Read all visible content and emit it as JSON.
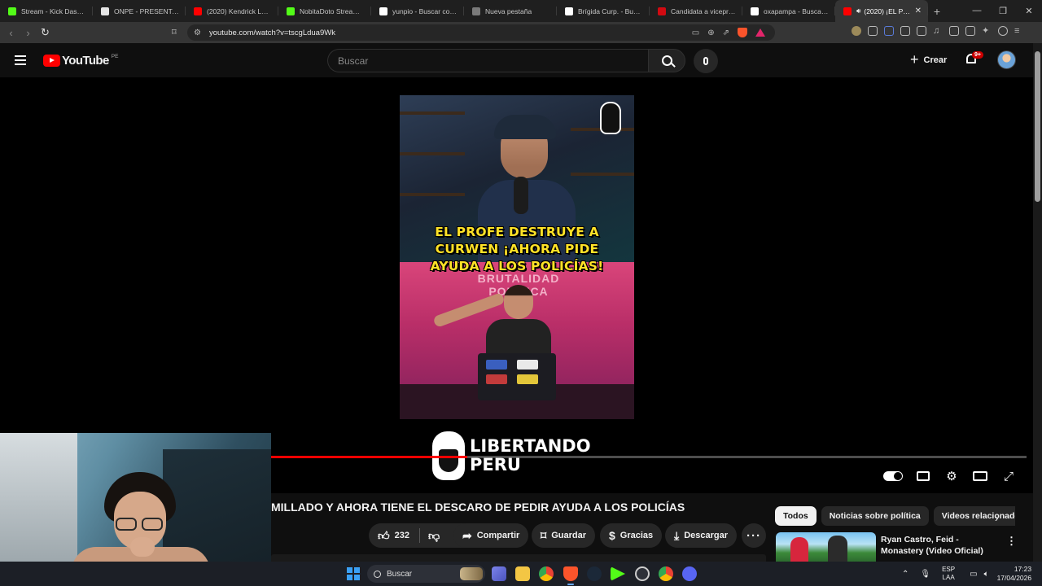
{
  "browser": {
    "tabs": [
      {
        "title": "Stream - Kick Dashboa",
        "icon": "kick-icon",
        "color": "#53fc18"
      },
      {
        "title": "ONPE - PRESENTACIÓN",
        "icon": "onpe-icon",
        "color": "#e6e6e6"
      },
      {
        "title": "(2020) Kendrick Lamar",
        "icon": "youtube-icon",
        "color": "#ff0000"
      },
      {
        "title": "NobitaDoto Stream - K",
        "icon": "kick-icon",
        "color": "#53fc18"
      },
      {
        "title": "yunpio - Buscar con Go",
        "icon": "google-icon",
        "color": "#ffffff"
      },
      {
        "title": "Nueva pestaña",
        "icon": "brave-icon",
        "color": "#7a7a7a"
      },
      {
        "title": "Brígida Curp. - Buscar c",
        "icon": "google-icon",
        "color": "#ffffff"
      },
      {
        "title": "Candidata a vicepresid",
        "icon": "lr-icon",
        "color": "#d10a11"
      },
      {
        "title": "oxapampa - Buscar con",
        "icon": "google-icon",
        "color": "#ffffff"
      },
      {
        "title": "(2020) ¡EL PROF",
        "icon": "youtube-icon",
        "color": "#ff0000",
        "active": true
      }
    ],
    "new_tab_label": "+",
    "url": "youtube.com/watch?v=tscgLdua9Wk"
  },
  "youtube": {
    "logo_word": "YouTube",
    "country_code": "PE",
    "search_placeholder": "Buscar",
    "create_label": "Crear",
    "notifications_badge": "9+"
  },
  "video": {
    "caption_lines": [
      "EL PROFE DESTRUYE A",
      "CURWEN ¡AHORA PIDE",
      "AYUDA A LOS POLICÍAS!"
    ],
    "background_text": "BRUTALIDAD POLÍTICA",
    "channel_watermark_line1": "LIBERTANDO",
    "channel_watermark_line2": "PERU",
    "progress_fraction": 0.26,
    "title": "MILLADO Y AHORA TIENE EL DESCARO DE PEDIR AYUDA A LOS POLICÍAS"
  },
  "actions": {
    "likes": "232",
    "share": "Compartir",
    "save": "Guardar",
    "thanks": "Gracias",
    "download": "Descargar"
  },
  "sidebar": {
    "chips": [
      "Todos",
      "Noticias sobre política",
      "Videos relacionados"
    ],
    "recommended": [
      {
        "title": "Ryan Castro, Feid - Monastery (Video Oficial)"
      }
    ]
  },
  "taskbar": {
    "search_label": "Buscar",
    "lang_line1": "ESP",
    "lang_line2": "LAA",
    "time": "17:23",
    "date": "17/04/2026"
  }
}
